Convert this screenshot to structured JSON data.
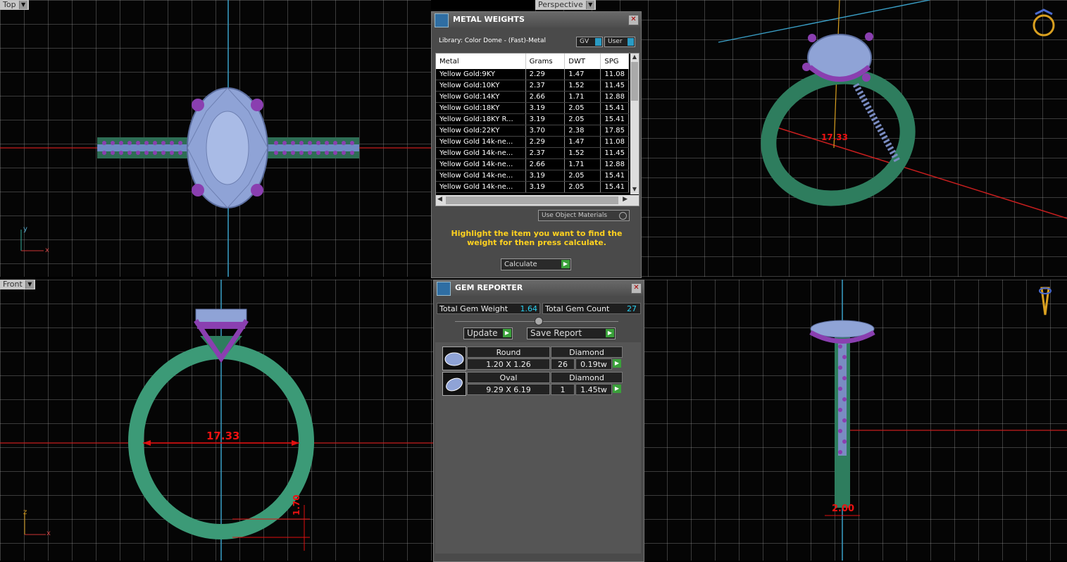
{
  "viewports": {
    "top": {
      "label": "Top",
      "axis_y": "y",
      "axis_x": "x"
    },
    "perspective": {
      "label": "Perspective",
      "dim_value": "17.33"
    },
    "front": {
      "label": "Front",
      "dim_diameter": "17.33",
      "dim_thickness": "1.70",
      "axis_z": "z",
      "axis_x": "x"
    },
    "side": {
      "label": "",
      "dim_width": "2.00"
    }
  },
  "metal_weights": {
    "title": "METAL WEIGHTS",
    "library": "Library: Color Dome - (Fast)-Metal",
    "gv_label": "GV",
    "user_label": "User",
    "columns": [
      "Metal",
      "Grams",
      "DWT",
      "SPG"
    ],
    "rows": [
      [
        "Yellow Gold:9KY",
        "2.29",
        "1.47",
        "11.08"
      ],
      [
        "Yellow Gold:10KY",
        "2.37",
        "1.52",
        "11.45"
      ],
      [
        "Yellow Gold:14KY",
        "2.66",
        "1.71",
        "12.88"
      ],
      [
        "Yellow Gold:18KY",
        "3.19",
        "2.05",
        "15.41"
      ],
      [
        "Yellow Gold:18KY R...",
        "3.19",
        "2.05",
        "15.41"
      ],
      [
        "Yellow Gold:22KY",
        "3.70",
        "2.38",
        "17.85"
      ],
      [
        "Yellow Gold 14k-ne...",
        "2.29",
        "1.47",
        "11.08"
      ],
      [
        "Yellow Gold 14k-ne...",
        "2.37",
        "1.52",
        "11.45"
      ],
      [
        "Yellow Gold 14k-ne...",
        "2.66",
        "1.71",
        "12.88"
      ],
      [
        "Yellow Gold 14k-ne...",
        "3.19",
        "2.05",
        "15.41"
      ],
      [
        "Yellow Gold 14k-ne...",
        "3.19",
        "2.05",
        "15.41"
      ]
    ],
    "use_object_materials": "Use Object Materials",
    "instructions": "Highlight the item you want to find the weight for then press calculate.",
    "calculate_label": "Calculate"
  },
  "gem_reporter": {
    "title": "GEM REPORTER",
    "total_weight_label": "Total Gem Weight",
    "total_weight_value": "1.64",
    "total_count_label": "Total Gem Count",
    "total_count_value": "27",
    "update_label": "Update",
    "save_report_label": "Save Report",
    "gems": [
      {
        "shape": "Round",
        "material": "Diamond",
        "size": "1.20 X 1.26",
        "count": "26",
        "weight": "0.19tw"
      },
      {
        "shape": "Oval",
        "material": "Diamond",
        "size": "9.29 X 6.19",
        "count": "1",
        "weight": "1.45tw"
      }
    ]
  },
  "colors": {
    "band": "#2e7d5e",
    "prong": "#8a3fb0",
    "stone": "#8fa3d6",
    "dimension": "#e01010",
    "accent_text": "#ffd21f"
  }
}
